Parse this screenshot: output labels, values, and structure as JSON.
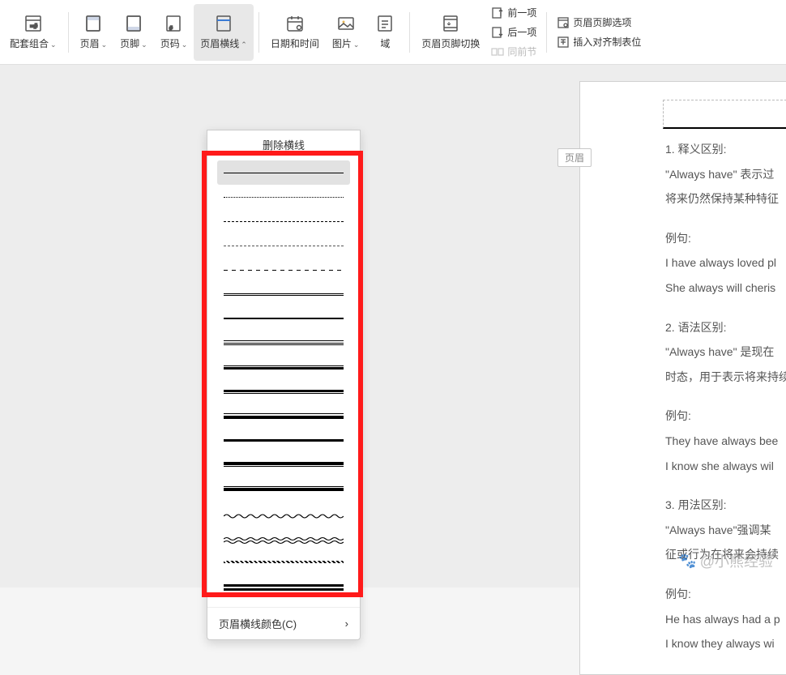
{
  "ribbon": {
    "combo": "配套组合",
    "header": "页眉",
    "footer": "页脚",
    "pageNum": "页码",
    "headerLine": "页眉横线",
    "dateTime": "日期和时间",
    "picture": "图片",
    "field": "域",
    "hfSwitch": "页眉页脚切换",
    "prevItem": "前一项",
    "nextItem": "后一项",
    "samePrev": "同前节",
    "hfOptions": "页眉页脚选项",
    "alignTab": "插入对齐制表位"
  },
  "dropdown": {
    "removeLine": "删除横线",
    "colorMenu": "页眉横线颜色(C)"
  },
  "doc": {
    "headerTag": "页眉",
    "lines": [
      "1.  释义区别:",
      "\"Always have\"  表示过",
      "将来仍然保持某种特征",
      "",
      "例句:",
      "I have always loved pl",
      "She always will cheris",
      "",
      "2.  语法区别:",
      "\"Always have\"  是现在",
      "时态，用于表示将来持续",
      "",
      "例句:",
      "They have always bee",
      "I know she always wil",
      "",
      "3.  用法区别:",
      "\"Always have\"强调某",
      "征或行为在将来会持续",
      "",
      "例句:",
      "He has always had a p",
      "I know they always wi"
    ]
  },
  "watermark": "@小熊经验"
}
